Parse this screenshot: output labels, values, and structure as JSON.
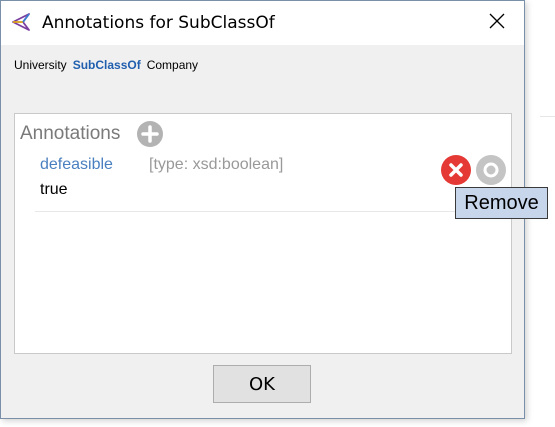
{
  "window": {
    "title": "Annotations for SubClassOf",
    "close_icon": "close-icon",
    "app_icon": "protege-icon"
  },
  "axiom": {
    "subject": "University",
    "relation": "SubClassOf",
    "object": "Company"
  },
  "annotations": {
    "header": "Annotations",
    "add_icon": "plus-circle-icon",
    "items": [
      {
        "property": "defeasible",
        "type": "[type: xsd:boolean]",
        "value": "true",
        "remove_icon": "remove-icon",
        "options_icon": "options-icon"
      }
    ]
  },
  "tooltip": {
    "text": "Remove"
  },
  "footer": {
    "ok_label": "OK"
  },
  "colors": {
    "remove_red": "#e53935",
    "add_gray": "#b3b3b3",
    "link_blue": "#1f5fae",
    "tooltip_bg": "#c8d6ec"
  }
}
